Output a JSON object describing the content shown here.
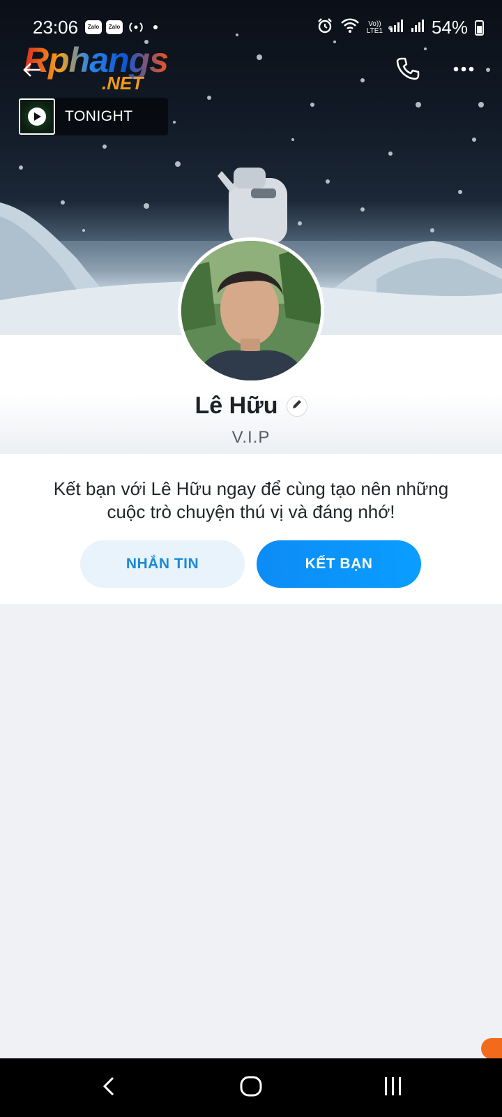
{
  "status_bar": {
    "time": "23:06",
    "notif_badge_1": "Zalo",
    "notif_badge_2": "Zalo",
    "battery_percent": "54%"
  },
  "logo": {
    "main": "Rphangs",
    "suffix": ".NET"
  },
  "header": {
    "icons": [
      "back-arrow-icon",
      "phone-icon",
      "more-icon"
    ]
  },
  "music": {
    "title": "TONIGHT"
  },
  "profile": {
    "name": "Lê Hữu",
    "bio": "V.I.P"
  },
  "invite": {
    "text": "Kết bạn với Lê Hữu ngay để cùng tạo nên những cuộc trò chuyện thú vị và đáng nhớ!",
    "message_button": "NHẮN TIN",
    "add_friend_button": "KẾT BẠN"
  },
  "colors": {
    "accent": "#0a9dff",
    "secondary_button_bg": "#e8f3fc",
    "secondary_button_text": "#1a89d8",
    "page_bg": "#eff1f5"
  }
}
